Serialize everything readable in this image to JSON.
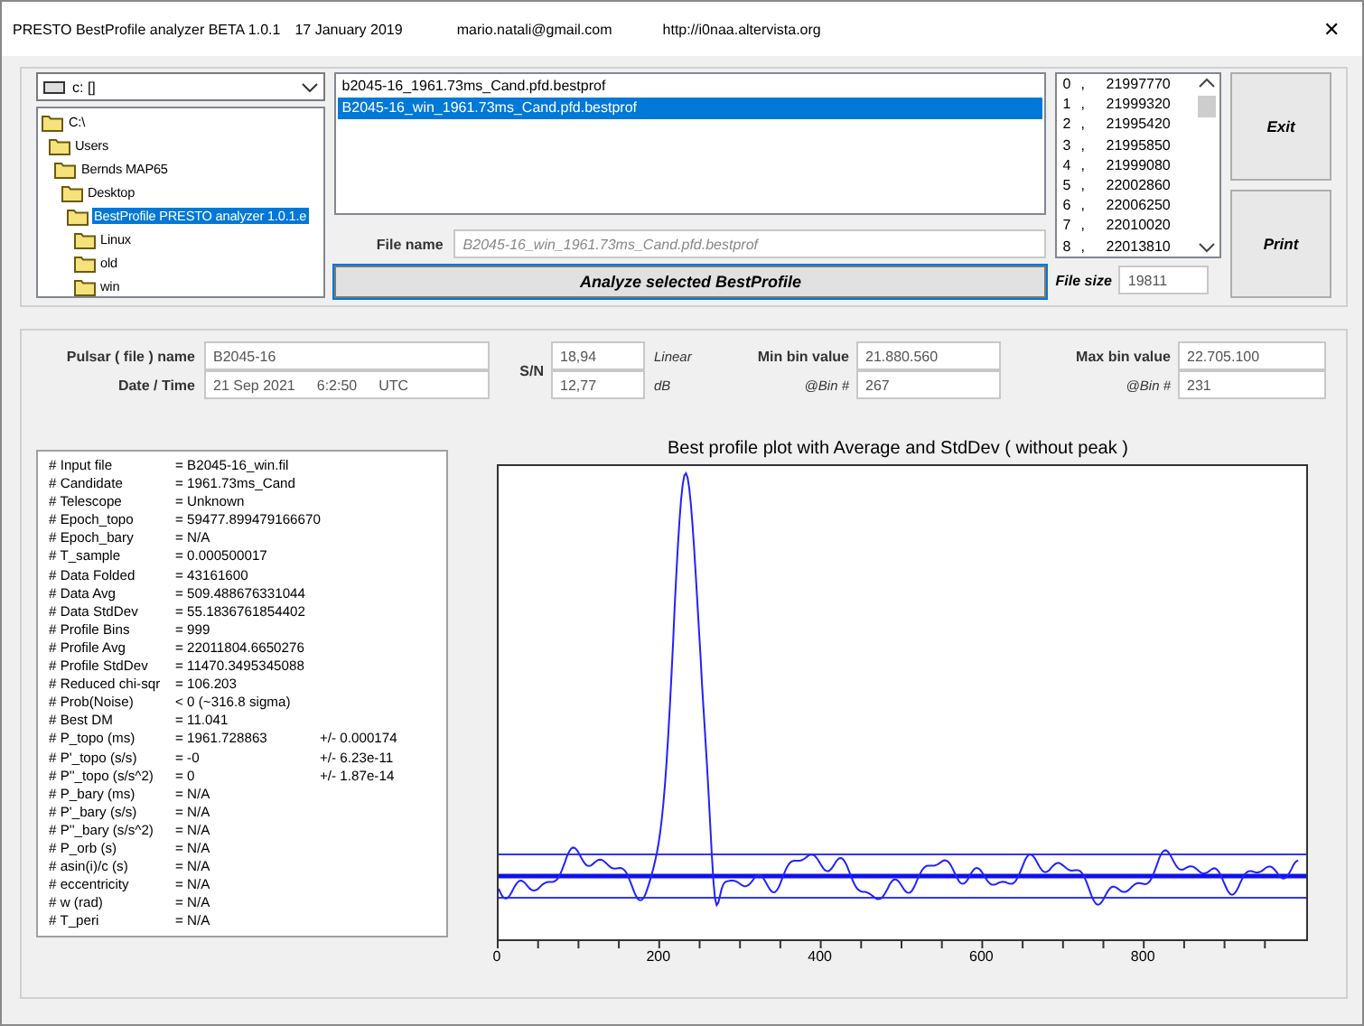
{
  "window": {
    "title": "PRESTO BestProfile analyzer BETA 1.0.1",
    "date": "17 January 2019",
    "email": "mario.natali@gmail.com",
    "website": "http://i0naa.altervista.org",
    "close": "✕"
  },
  "drive": {
    "value": "c: []"
  },
  "folders": [
    {
      "label": "C:\\",
      "selected": false,
      "children": [
        {
          "label": "Users",
          "selected": false,
          "children": [
            {
              "label": "Bernds MAP65",
              "selected": false,
              "children": [
                {
                  "label": "Desktop",
                  "selected": false,
                  "children": [
                    {
                      "label": "BestProfile PRESTO analyzer 1.0.1.e",
                      "selected": true,
                      "children": [
                        {
                          "label": "Linux",
                          "selected": false
                        },
                        {
                          "label": "old",
                          "selected": false
                        },
                        {
                          "label": "win",
                          "selected": false
                        }
                      ]
                    }
                  ]
                }
              ]
            }
          ]
        }
      ]
    }
  ],
  "files": [
    {
      "label": "b2045-16_1961.73ms_Cand.pfd.bestprof",
      "selected": false
    },
    {
      "label": "B2045-16_win_1961.73ms_Cand.pfd.bestprof",
      "selected": true
    }
  ],
  "file_name": {
    "label": "File name",
    "value": "B2045-16_win_1961.73ms_Cand.pfd.bestprof",
    "disabled": true
  },
  "analyze_button": "Analyze selected BestProfile",
  "bins": [
    {
      "index": "0",
      "separator": ",",
      "value": "21997770"
    },
    {
      "index": "1",
      "separator": ",",
      "value": "21999320"
    },
    {
      "index": "2",
      "separator": ",",
      "value": "21995420"
    },
    {
      "index": "3",
      "separator": ",",
      "value": "21995850"
    },
    {
      "index": "4",
      "separator": ",",
      "value": "21999080"
    },
    {
      "index": "5",
      "separator": ",",
      "value": "22002860"
    },
    {
      "index": "6",
      "separator": ",",
      "value": "22006250"
    },
    {
      "index": "7",
      "separator": ",",
      "value": "22010020"
    },
    {
      "index": "8",
      "separator": ",",
      "value": "22013810"
    }
  ],
  "file_size": {
    "label": "File size",
    "value": "19811"
  },
  "buttons": [
    {
      "label": "Exit"
    },
    {
      "label": "Print"
    }
  ],
  "pulsar": {
    "label": "Pulsar ( file ) name",
    "value": "B2045-16"
  },
  "date_time": {
    "label": "Date / Time",
    "date": "21 Sep 2021",
    "time": "6:2:50",
    "zone": "UTC"
  },
  "sn": {
    "label": "S/N",
    "linear": "18,94",
    "linear_unit": "Linear",
    "db": "12,77",
    "db_unit": "dB"
  },
  "min_bin": {
    "label": "Min bin value",
    "value": "21.880.560",
    "bin_label": "@Bin #",
    "bin": "267"
  },
  "max_bin": {
    "label": "Max bin value",
    "value": "22.705.100",
    "bin_label": "@Bin #",
    "bin": "231"
  },
  "info": [
    {
      "label": "# Input file",
      "value": "= B2045-16_win.fil"
    },
    {
      "label": "# Candidate",
      "value": "= 1961.73ms_Cand"
    },
    {
      "label": "# Telescope",
      "value": "= Unknown"
    },
    {
      "label": "# Epoch_topo",
      "value": "= 59477.899479166670"
    },
    {
      "label": "# Epoch_bary",
      "value": "= N/A"
    },
    {
      "label": "# T_sample",
      "value": "= 0.000500017"
    },
    {
      "label": "# Data Folded",
      "value": "= 43161600"
    },
    {
      "label": "# Data Avg",
      "value": "= 509.488676331044"
    },
    {
      "label": "# Data StdDev",
      "value": "= 55.1836761854402"
    },
    {
      "label": "# Profile Bins",
      "value": "= 999"
    },
    {
      "label": "# Profile Avg",
      "value": "= 22011804.6650276"
    },
    {
      "label": "# Profile StdDev",
      "value": "= 11470.3495345088"
    },
    {
      "label": "# Reduced chi-sqr",
      "value": "= 106.203"
    },
    {
      "label": "# Prob(Noise)",
      "value": "<  0   (~316.8 sigma)"
    },
    {
      "label": "# Best DM",
      "value": "= 11.041"
    },
    {
      "label": "# P_topo (ms)",
      "value": "= 1961.728863",
      "error": "+/- 0.000174"
    },
    {
      "label": "# P'_topo (s/s)",
      "value": "= -0",
      "error": "+/- 6.23e-11"
    },
    {
      "label": "# P''_topo (s/s^2)",
      "value": "= 0",
      "error": "+/- 1.87e-14"
    },
    {
      "label": "# P_bary (ms)",
      "value": "= N/A"
    },
    {
      "label": "# P'_bary (s/s)",
      "value": "= N/A"
    },
    {
      "label": "# P''_bary (s/s^2)",
      "value": "= N/A"
    },
    {
      "label": "# P_orb (s)",
      "value": "= N/A"
    },
    {
      "label": "# asin(i)/c (s)",
      "value": "= N/A"
    },
    {
      "label": "# eccentricity",
      "value": "= N/A"
    },
    {
      "label": "# w (rad)",
      "value": "= N/A"
    },
    {
      "label": "# T_peri",
      "value": "= N/A"
    }
  ],
  "plot": {
    "title": "Best profile plot with  Average and StdDev ( without peak )",
    "x_tick_labels": [
      "0",
      "200",
      "400",
      "600",
      "800"
    ]
  }
}
